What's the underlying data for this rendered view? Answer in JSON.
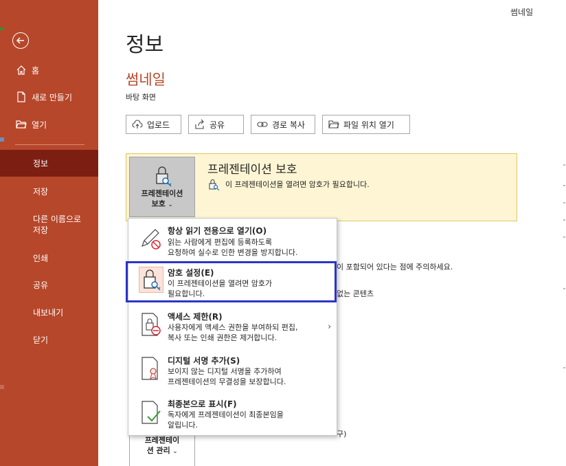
{
  "header": {
    "right_label": "썸네일"
  },
  "sidebar": {
    "items": [
      {
        "label": "홈",
        "icon": "home-icon"
      },
      {
        "label": "새로 만들기",
        "icon": "new-file-icon"
      },
      {
        "label": "열기",
        "icon": "open-folder-icon"
      },
      {
        "label": "정보",
        "active": true
      },
      {
        "label": "저장"
      },
      {
        "label": "다른 이름으로\n저장"
      },
      {
        "label": "인쇄"
      },
      {
        "label": "공유"
      },
      {
        "label": "내보내기"
      },
      {
        "label": "닫기"
      }
    ]
  },
  "main": {
    "page_title": "정보",
    "doc_title": "썸네일",
    "doc_location": "바탕 화면",
    "buttons": [
      {
        "label": "업로드",
        "icon": "upload-icon"
      },
      {
        "label": "공유",
        "icon": "share-icon"
      },
      {
        "label": "경로 복사",
        "icon": "link-icon"
      },
      {
        "label": "파일 위치 열기",
        "icon": "folder-icon"
      }
    ],
    "protect": {
      "button_label_1": "프레젠테이션",
      "button_label_2": "보호",
      "title": "프레젠테이션 보호",
      "desc": "이 프레젠테이션을 열려면 암호가 필요합니다."
    },
    "bg_text_1": "이 포함되어 있다는 점에 주의하세요.",
    "bg_text_2": "없는 콘텐츠",
    "bg_text_3": "구)",
    "manage": {
      "label_1": "프레젠테이",
      "label_2": "션 관리"
    }
  },
  "menu": {
    "items": [
      {
        "title": "항상 읽기 전용으로 열기(O)",
        "desc": "읽는 사람에게 편집에 등록하도록\n요청하여 실수로 인한 변경을 방지합니다.",
        "icon": "pencil-no-icon"
      },
      {
        "title": "암호 설정(E)",
        "desc": "이 프레젠테이션을 열려면 암호가\n필요합니다.",
        "icon": "lock-key-icon",
        "highlighted": true
      },
      {
        "title": "액세스 제한(R)",
        "desc": "사용자에게 액세스 권한을 부여하되 편집,\n복사 또는 인쇄 권한은 제거합니다.",
        "icon": "restrict-access-icon",
        "has_submenu": true
      },
      {
        "title": "디지털 서명 추가(S)",
        "desc": "보이지 않는 디지털 서명을 추가하여\n프레젠테이션의 무결성을 보장합니다.",
        "icon": "signature-icon"
      },
      {
        "title": "최종본으로 표시(F)",
        "desc": "독자에게 프레젠테이션이 최종본임을\n알립니다.",
        "icon": "mark-final-icon"
      }
    ]
  },
  "colors": {
    "accent": "#b7472a",
    "active_nav": "#7c1f12",
    "highlight_border": "#2a34c8",
    "protect_bg": "#fdf5d3"
  }
}
